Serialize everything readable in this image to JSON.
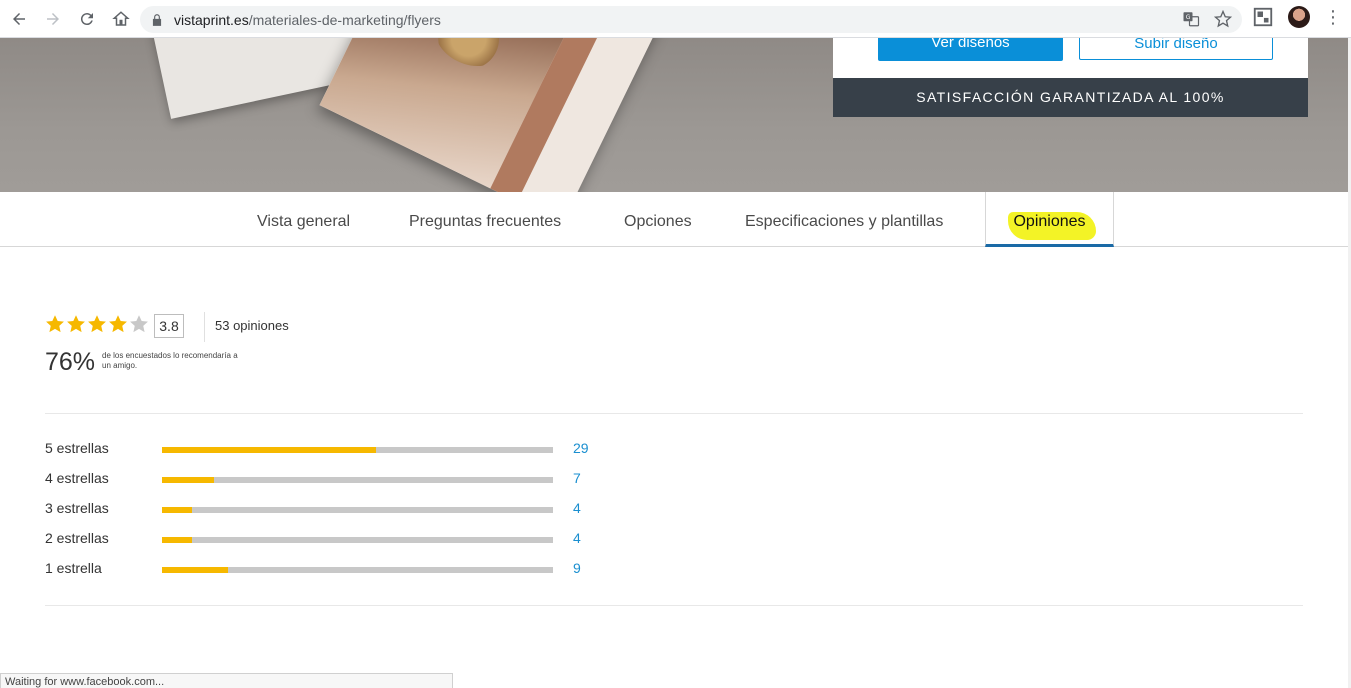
{
  "browser": {
    "url_domain": "vistaprint.es",
    "url_path": "/materiales-de-marketing/flyers",
    "status_text": "Waiting for www.facebook.com..."
  },
  "hero": {
    "primary_button": "Ver diseños",
    "secondary_button": "Subir diseño",
    "guarantee": "SATISFACCIÓN GARANTIZADA AL 100%"
  },
  "tabs": [
    {
      "label": "Vista general"
    },
    {
      "label": "Preguntas frecuentes"
    },
    {
      "label": "Opciones"
    },
    {
      "label": "Especificaciones y plantillas"
    },
    {
      "label": "Opiniones",
      "active": true
    }
  ],
  "reviews": {
    "rating": "3.8",
    "rating_value": 3.8,
    "stars_max": 5,
    "count_label": "53 opiniones",
    "recommend_percent": "76%",
    "recommend_note": "de los encuestados lo recomendaría a un amigo.",
    "distribution": [
      {
        "label": "5 estrellas",
        "count": "29",
        "value": 29
      },
      {
        "label": "4 estrellas",
        "count": "7",
        "value": 7
      },
      {
        "label": "3 estrellas",
        "count": "4",
        "value": 4
      },
      {
        "label": "2 estrellas",
        "count": "4",
        "value": 4
      },
      {
        "label": "1 estrella",
        "count": "9",
        "value": 9
      }
    ],
    "total": 53
  },
  "colors": {
    "star_filled": "#f6b800",
    "star_empty": "#c8c8c8",
    "accent_blue": "#0a8fd8",
    "tab_active_underline": "#1a6aa6",
    "guarantee_bg": "#374049"
  }
}
